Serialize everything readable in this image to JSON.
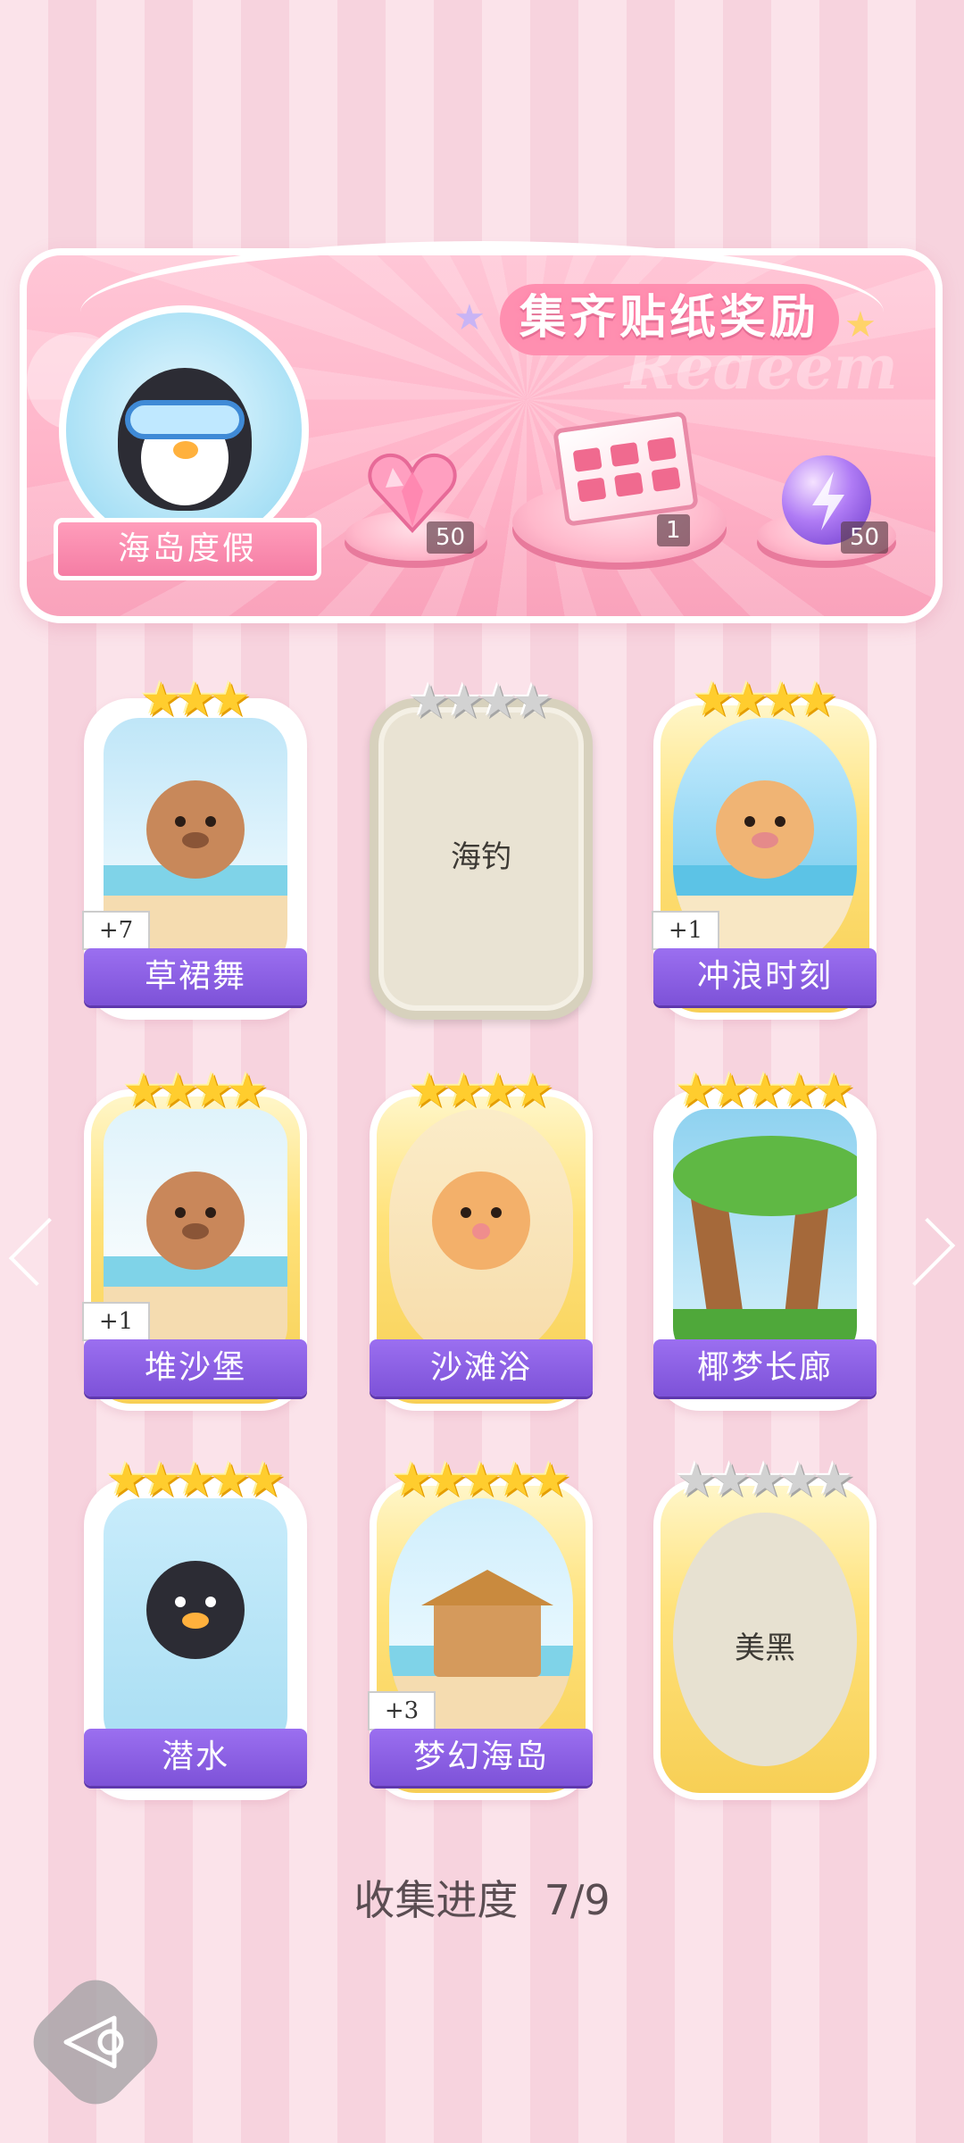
{
  "banner": {
    "title": "集齐贴纸奖励",
    "watermark": "Redeem",
    "theme_name": "海岛度假",
    "rewards": [
      {
        "icon": "pink-heart-gem-icon",
        "count": "50"
      },
      {
        "icon": "gift-box-icon",
        "count": "1"
      },
      {
        "icon": "lightning-orb-icon",
        "count": "50"
      }
    ]
  },
  "stickers": [
    {
      "name": "草裙舞",
      "stars": 3,
      "max_stars": 3,
      "collected": true,
      "extra": "+7"
    },
    {
      "name": "海钓",
      "stars": 0,
      "max_stars": 4,
      "collected": false,
      "extra": ""
    },
    {
      "name": "冲浪时刻",
      "stars": 4,
      "max_stars": 4,
      "collected": true,
      "extra": "+1"
    },
    {
      "name": "堆沙堡",
      "stars": 4,
      "max_stars": 4,
      "collected": true,
      "extra": "+1"
    },
    {
      "name": "沙滩浴",
      "stars": 4,
      "max_stars": 4,
      "collected": true,
      "extra": ""
    },
    {
      "name": "椰梦长廊",
      "stars": 5,
      "max_stars": 5,
      "collected": true,
      "extra": ""
    },
    {
      "name": "潜水",
      "stars": 5,
      "max_stars": 5,
      "collected": true,
      "extra": ""
    },
    {
      "name": "梦幻海岛",
      "stars": 5,
      "max_stars": 5,
      "collected": true,
      "extra": "+3"
    },
    {
      "name": "美黑",
      "stars": 0,
      "max_stars": 5,
      "collected": false,
      "extra": ""
    }
  ],
  "progress": {
    "label": "收集进度",
    "value": "7/9"
  },
  "colors": {
    "accent_purple": "#8a5fe4",
    "star_gold": "#ffcd2e",
    "banner_pink": "#ffb3c8"
  }
}
